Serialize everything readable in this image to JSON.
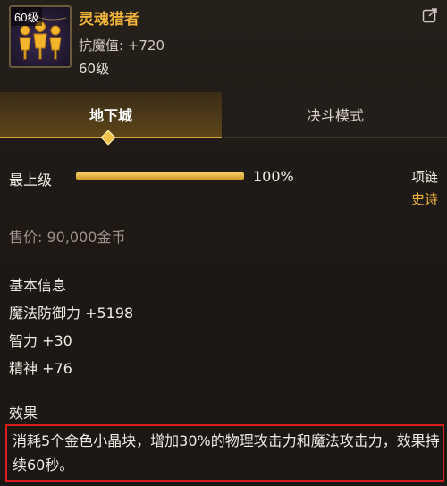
{
  "item": {
    "level_badge": "60级",
    "name": "灵魂猎者",
    "resist": "抗魔值: +720",
    "required_level": "60级"
  },
  "tabs": [
    {
      "label": "地下城",
      "active": true
    },
    {
      "label": "决斗模式",
      "active": false
    }
  ],
  "upgrade": {
    "label": "最上级",
    "progress_pct": 100,
    "progress_text": "100%"
  },
  "slot": "项链",
  "rarity": "史诗",
  "price": "售价: 90,000金币",
  "basic_info": {
    "title": "基本信息",
    "stats": [
      "魔法防御力 +5198",
      "智力 +30",
      "精神 +76"
    ]
  },
  "effect": {
    "title": "效果",
    "text": "消耗5个金色小晶块，增加30%的物理攻击力和魔法攻击力，效果持续60秒。"
  },
  "colors": {
    "gold": "#f0b43a",
    "highlight_border": "#d92020"
  }
}
